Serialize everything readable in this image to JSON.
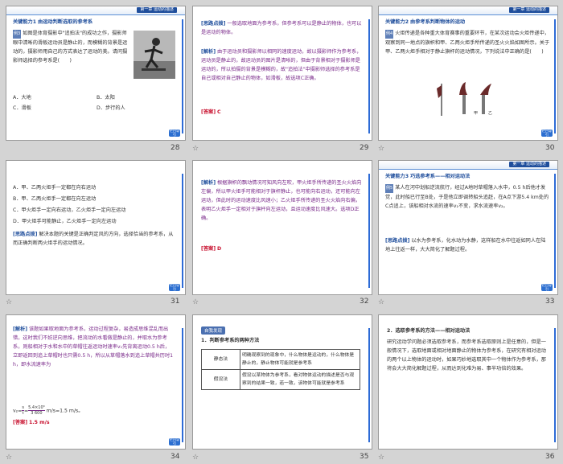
{
  "common": {
    "header_tag": "第一章  运动的描述",
    "corner_label": "栏目导引"
  },
  "slides": [
    {
      "page": "28",
      "heading_label": "关键能力1",
      "heading_text": "由运动判断选取的参考系",
      "example_tag": "例3",
      "body": "如图是体育摄影中\"追拍法\"的成功之作，摄影师眼中清晰的滑板运动员是静止的，而模糊的背景是运动的，摄影师用自己的方式表达了运动的美。请问摄影师选择的参考系是(　　)",
      "options": [
        "A．大地",
        "B．太阳",
        "C．滑板",
        "D．步行的人"
      ]
    },
    {
      "page": "29",
      "tip_label": "[思路点拨]",
      "tip_text": "一般选取地面为参考系，但参考系可以是静止的物体，也可以是运动的物体。",
      "analysis_label": "[解析]",
      "analysis_text": "由于运动员和摄影师以相同的速度运动，故以摄影师作为参考系，运动员是静止的，故运动员的图片是清晰的，但由于背景相对于摄影师是运动的，所以拍摄的背景是模糊的，故\"追拍法\"中摄影师选择的参考系是自己或相对自己静止的物体，如滑板，故选项C正确。",
      "answer_label": "[答案]",
      "answer_text": "C"
    },
    {
      "page": "30",
      "heading_label": "关键能力2",
      "heading_text": "由参考系判断物体的运动",
      "example_tag": "例4",
      "body": "火炬传递是各种重大体育赛事的重要环节，在某次运动会火炬传递中，观察到同一地点的旗帜和甲、乙两火炬手所传递的圣火火焰如图所示。关于甲、乙两火炬手相对于静止旗杆的运动情况，下列说法中正确的是(　　)",
      "figure_labels": [
        "甲",
        "乙"
      ]
    },
    {
      "page": "31",
      "options": [
        "A．甲、乙两火炬手一定都在向右运动",
        "B．甲、乙两火炬手一定都在向左运动",
        "C．甲火炬手一定向右运动，乙火炬手一定向左运动",
        "D．甲火炬手可能静止，乙火炬手一定向左运动"
      ],
      "tip_label": "[思路点拨]",
      "tip_text": "解决本题的关键是正确判定风的方向，选择恰当的参考系，从而正确判断两火炬手的运动情况。"
    },
    {
      "page": "32",
      "analysis_label": "[解析]",
      "analysis_text": "根据旗帜的飘动情况可知风向左吹，甲火炬手所传递的圣火火焰向左偏，所以甲火炬手可能相对于旗杆静止，也可能向右运动，还可能向左运动，但此时的运动速度比风速小；乙火炬手所传递的圣火火焰向右偏，表明乙火炬手一定相对于旗杆向左运动，且运动速度比风速大。选项D正确。",
      "answer_label": "[答案]",
      "answer_text": "D"
    },
    {
      "page": "33",
      "heading_label": "关键能力3",
      "heading_text": "巧选参考系——相对运动法",
      "example_tag": "例5",
      "body": "某人在河中划船逆流航行，经过A地时草帽落入水中，0.5 h后他才发觉，此时船已行至B处，于是他立即调转船头追赶，在A点下游5.4 km处的C点追上，该船相对水流的速率v₁不变，求水流速率v₂。",
      "tip_label": "[思路点拨]",
      "tip_text": "以水为参考系，化水动为水静，这样船在水中往返如同人在陆地上往返一样，大大简化了解题过程。"
    },
    {
      "page": "34",
      "analysis_label": "[解析]",
      "analysis_text": "该题如果取地面为参考系，运动过程复杂，易造成思维混乱而出错，这时我们不妨逆向思维，把流动的水看做是静止的，并取水为参考系，则船相对于水和水中的草帽往返运动时速率v₁先背离运动0.5 h后，立即返回到追上草帽时也只需0.5 h，所以从草帽落水到追上草帽共历时1 h，即水流速率为",
      "formula_prefix": "v₂=",
      "formula_s": "s",
      "formula_t": "t",
      "formula_num": "5.4×10³",
      "formula_den": "3 600",
      "formula_result": "m/s=1.5 m/s。",
      "answer_label": "[答案]",
      "answer_text": "1.5 m/s"
    },
    {
      "page": "35",
      "badge": "自我发现",
      "subtitle": "1．判断参考系的两种方法",
      "table": [
        {
          "method": "静态法",
          "desc": "明确观察到的现象中，什么物体是运动的，什么物体是静止的，静止物体可能就是参考系"
        },
        {
          "method": "假设法",
          "desc": "假设以某物体为参考系，看对物体运动的描述是否与观察到的结果一致，若一致，该物体可能就是参考系"
        }
      ]
    },
    {
      "page": "36",
      "subtitle": "2．选取参考系的方法——相对运动法",
      "body": "研究运动学问题必须选取参考系，而参考系选取原则上是任意的，但是一般情况下，选取地面或相对地面静止的物体为参考系，在研究有相对运动的两个以上物体的运动时，如果巧妙地选取其中一个物体作为参考系，那将会大大简化解题过程，从而达到化难为易、事半功倍的效果。"
    }
  ],
  "colors": {
    "accent_blue": "#1f4e9c",
    "analysis_purple": "#7a2a8a",
    "answer_red": "#c8102e"
  }
}
